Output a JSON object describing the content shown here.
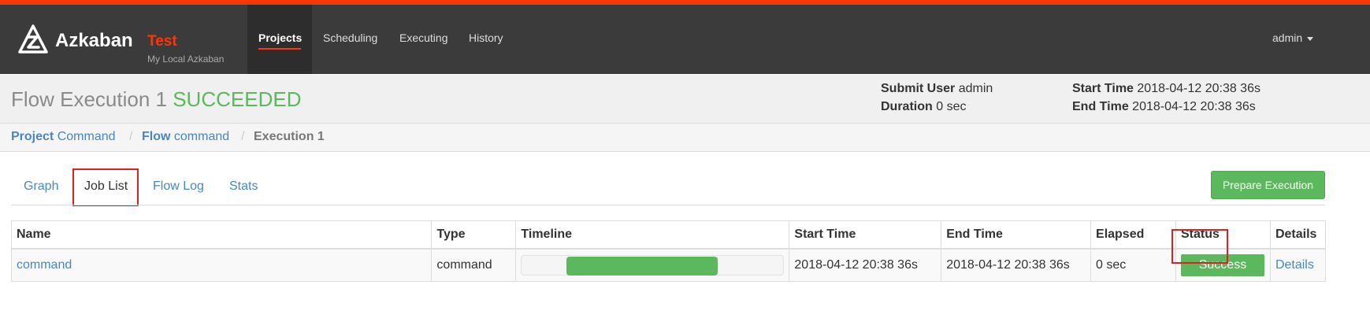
{
  "navbar": {
    "brand_name": "Azkaban",
    "brand_env": "Test",
    "brand_subtitle": "My Local Azkaban",
    "items": [
      {
        "label": "Projects",
        "active": true
      },
      {
        "label": "Scheduling",
        "active": false
      },
      {
        "label": "Executing",
        "active": false
      },
      {
        "label": "History",
        "active": false
      }
    ],
    "user": "admin",
    "accent_color": "#ff3601"
  },
  "header": {
    "title": "Flow Execution 1",
    "status": "SUCCEEDED",
    "status_color": "#5cb85c",
    "submit_user_label": "Submit User",
    "submit_user": "admin",
    "duration_label": "Duration",
    "duration": "0 sec",
    "start_time_label": "Start Time",
    "start_time": "2018-04-12 20:38 36s",
    "end_time_label": "End Time",
    "end_time": "2018-04-12 20:38 36s"
  },
  "breadcrumb": {
    "project_label": "Project",
    "project": "Command",
    "flow_label": "Flow",
    "flow": "command",
    "execution": "Execution 1",
    "separator": "/"
  },
  "tabs": [
    {
      "label": "Graph",
      "active": false
    },
    {
      "label": "Job List",
      "active": true
    },
    {
      "label": "Flow Log",
      "active": false
    },
    {
      "label": "Stats",
      "active": false
    }
  ],
  "prepare_button": "Prepare Execution",
  "job_table": {
    "columns": [
      "Name",
      "Type",
      "Timeline",
      "Start Time",
      "End Time",
      "Elapsed",
      "Status",
      "Details"
    ],
    "rows": [
      {
        "name": "command",
        "type": "command",
        "timeline_start_fraction": 0.17,
        "timeline_end_fraction": 0.75,
        "start_time": "2018-04-12 20:38 36s",
        "end_time": "2018-04-12 20:38 36s",
        "elapsed": "0 sec",
        "status": "Success",
        "details": "Details"
      }
    ]
  }
}
